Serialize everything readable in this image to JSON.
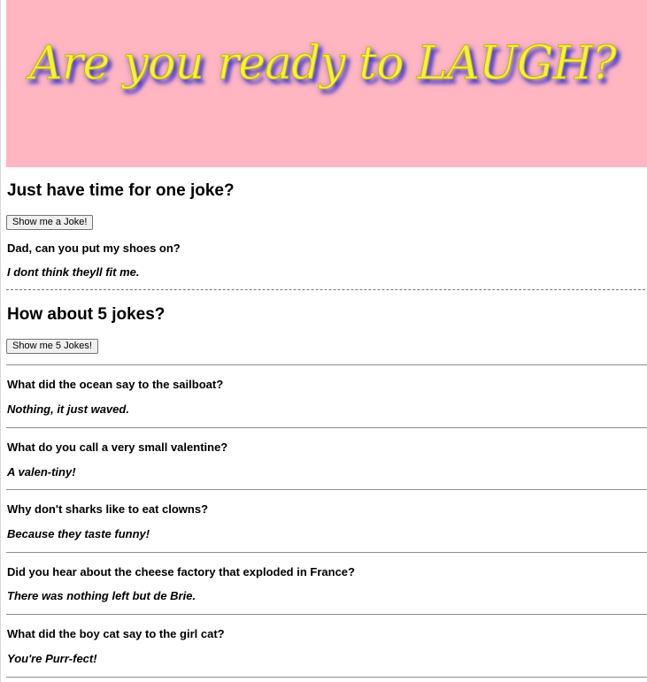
{
  "header": {
    "banner_title": "Are you ready to LAUGH?",
    "banner_background": "#ffb6c1",
    "banner_text_color": "#f3f33a"
  },
  "single_joke": {
    "heading": "Just have time for one joke?",
    "button_label": "Show me a Joke!",
    "question": "Dad, can you put my shoes on?",
    "answer": "I dont think theyll fit me."
  },
  "five_jokes": {
    "heading": "How about 5 jokes?",
    "button_label": "Show me 5 Jokes!",
    "jokes": [
      {
        "question": "What did the ocean say to the sailboat?",
        "answer": "Nothing, it just waved."
      },
      {
        "question": "What do you call a very small valentine?",
        "answer": "A valen-tiny!"
      },
      {
        "question": "Why don't sharks like to eat clowns?",
        "answer": "Because they taste funny!"
      },
      {
        "question": "Did you hear about the cheese factory that exploded in France?",
        "answer": "There was nothing left but de Brie."
      },
      {
        "question": "What did the boy cat say to the girl cat?",
        "answer": "You're Purr-fect!"
      }
    ]
  }
}
